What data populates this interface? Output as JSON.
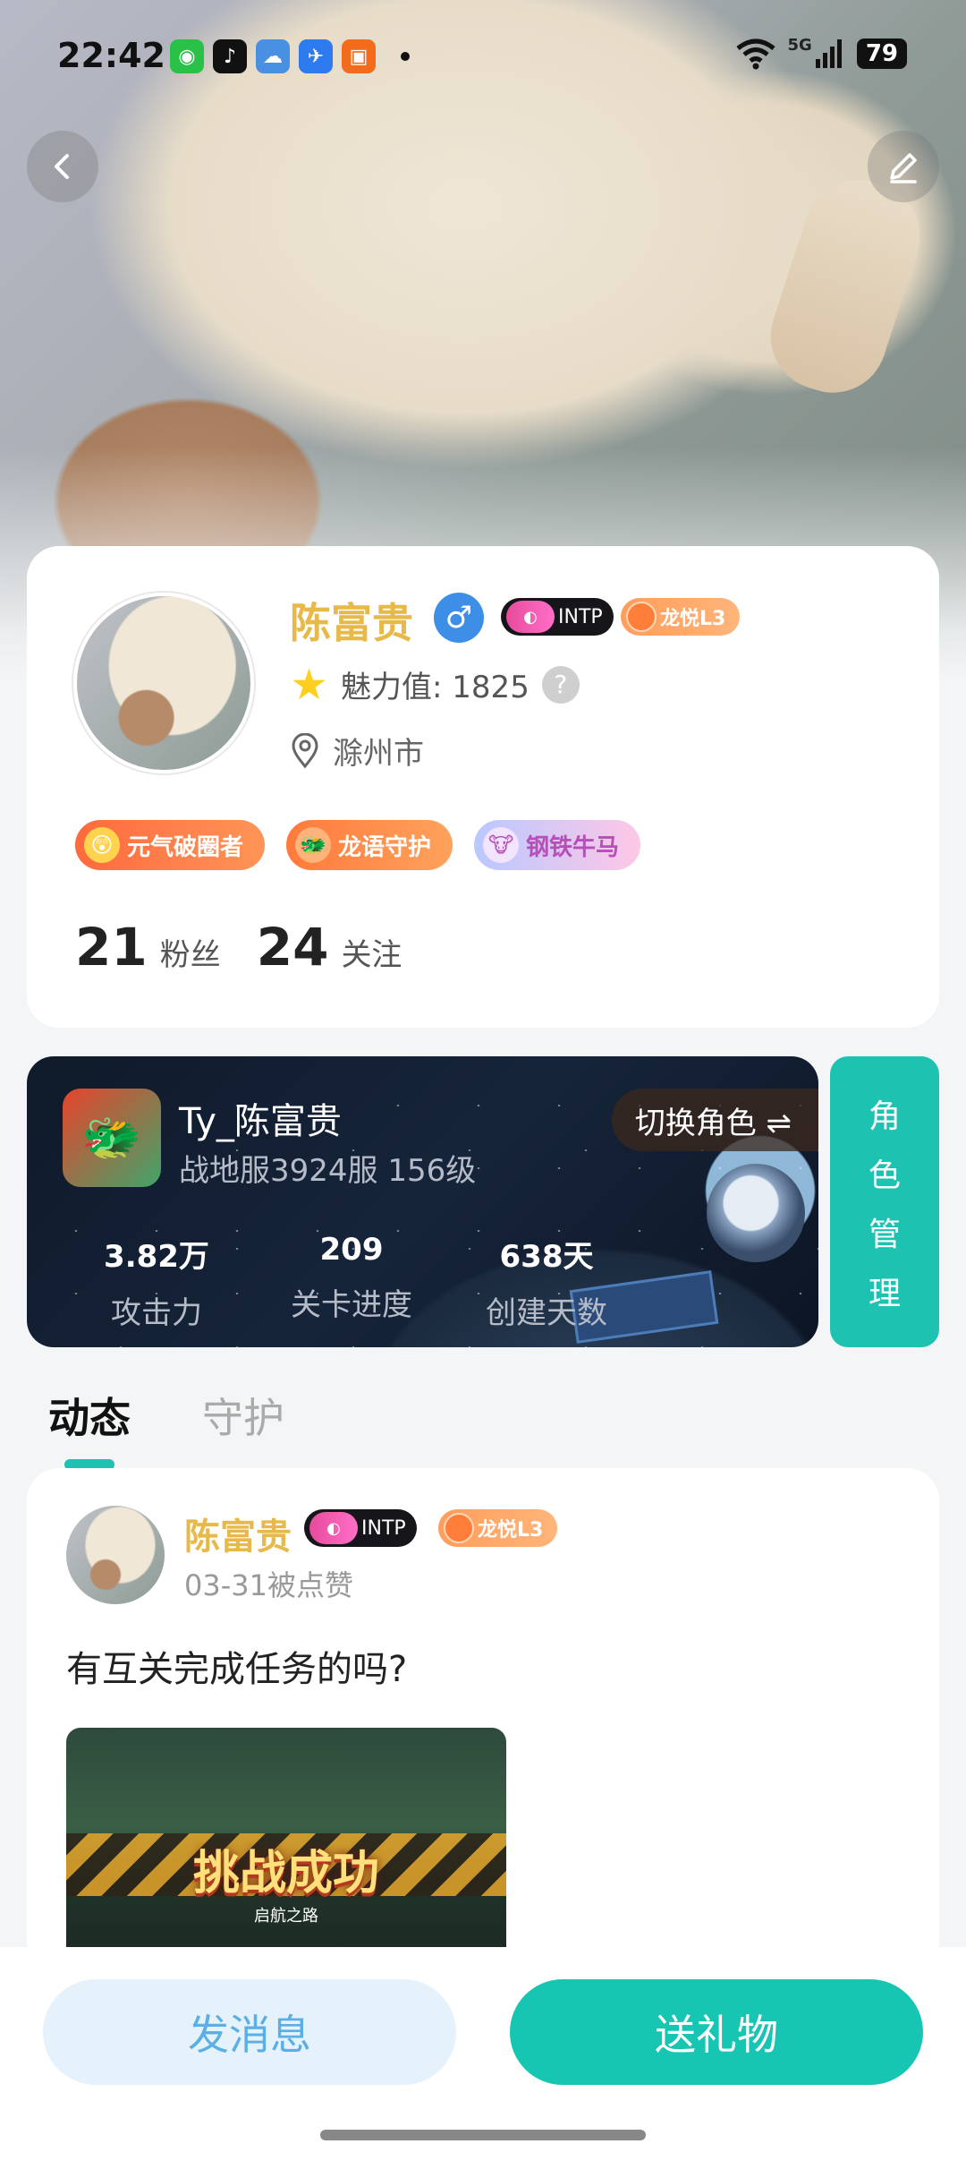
{
  "status_bar": {
    "time": "22:42",
    "apps": [
      {
        "icon": "wechat-icon",
        "color": "#2ac246",
        "glyph": "◉"
      },
      {
        "icon": "tiktok-icon",
        "color": "#111111",
        "glyph": "♪"
      },
      {
        "icon": "weather-icon",
        "color": "#4a90e2",
        "glyph": "☁"
      },
      {
        "icon": "app-icon",
        "color": "#2e7bef",
        "glyph": "✈"
      },
      {
        "icon": "orange-app-icon",
        "color": "#f36b1c",
        "glyph": "▣"
      }
    ],
    "network": "5G",
    "battery": "79"
  },
  "profile": {
    "name": "陈富贵",
    "gender_symbol": "♂",
    "mbti": "INTP",
    "level": "龙悦L3",
    "charm_label": "魅力值: 1825",
    "location": "滁州市",
    "badges": [
      {
        "label": "元气破圈者",
        "icon": "😲"
      },
      {
        "label": "龙语守护",
        "icon": "🐲"
      },
      {
        "label": "钢铁牛马",
        "icon": "🐮"
      }
    ],
    "fans_count": "21",
    "fans_label": "粉丝",
    "follow_count": "24",
    "follow_label": "关注"
  },
  "game_card": {
    "role_name": "Ty_陈富贵",
    "server": "战地服3924服 156级",
    "switch_label": "切换角色 ⇌",
    "stats": [
      {
        "value": "3.82万",
        "label": "攻击力"
      },
      {
        "value": "209",
        "label": "关卡进度"
      },
      {
        "value": "638天",
        "label": "创建天数"
      }
    ],
    "manage_chars": [
      "角",
      "色",
      "管",
      "理"
    ]
  },
  "tabs": [
    {
      "label": "动态",
      "active": true
    },
    {
      "label": "守护",
      "active": false
    }
  ],
  "post": {
    "author": "陈富贵",
    "mbti": "INTP",
    "level": "龙悦L3",
    "meta": "03-31被点赞",
    "text": "有互关完成任务的吗?",
    "image_title": "挑战成功",
    "image_subtitle": "启航之路"
  },
  "actions": {
    "message_label": "发消息",
    "gift_label": "送礼物"
  },
  "colors": {
    "accent": "#1ec2b0",
    "name_gold": "#e7b94a",
    "message_button_bg": "#e5f2fb"
  }
}
